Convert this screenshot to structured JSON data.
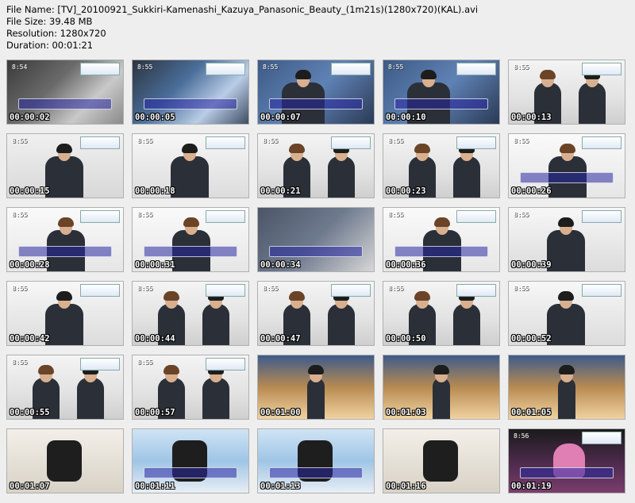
{
  "info": {
    "file_name": "File Name: [TV]_20100921_Sukkiri-Kamenashi_Kazuya_Panasonic_Beauty_(1m21s)(1280x720)(KAL).avi",
    "file_size": "File Size: 39.48 MB",
    "resolution": "Resolution: 1280x720",
    "duration": "Duration: 00:01:21"
  },
  "thumbnails": [
    {
      "ts": "00:00:02",
      "scene": "stage-dark",
      "clock": "8:54"
    },
    {
      "ts": "00:00:05",
      "scene": "stage-blue",
      "clock": "8:55"
    },
    {
      "ts": "00:00:07",
      "scene": "closeup-blue",
      "clock": "8:55"
    },
    {
      "ts": "00:00:10",
      "scene": "closeup-blue",
      "clock": "8:55"
    },
    {
      "ts": "00:00:13",
      "scene": "two-men",
      "clock": "8:55"
    },
    {
      "ts": "00:00:15",
      "scene": "side-man",
      "clock": "8:55"
    },
    {
      "ts": "00:00:18",
      "scene": "man-mic",
      "clock": "8:55"
    },
    {
      "ts": "00:00:21",
      "scene": "two-men",
      "clock": "8:55"
    },
    {
      "ts": "00:00:23",
      "scene": "two-men",
      "clock": "8:55"
    },
    {
      "ts": "00:00:26",
      "scene": "young-man",
      "clock": "8:55"
    },
    {
      "ts": "00:00:28",
      "scene": "young-man",
      "clock": "8:55"
    },
    {
      "ts": "00:00:31",
      "scene": "young-man",
      "clock": "8:55"
    },
    {
      "ts": "00:00:34",
      "scene": "pants",
      "clock": ""
    },
    {
      "ts": "00:00:36",
      "scene": "young-man",
      "clock": "8:55"
    },
    {
      "ts": "00:00:39",
      "scene": "man-mic",
      "clock": "8:55"
    },
    {
      "ts": "00:00:42",
      "scene": "man-mic",
      "clock": "8:55"
    },
    {
      "ts": "00:00:44",
      "scene": "two-men",
      "clock": "8:55"
    },
    {
      "ts": "00:00:47",
      "scene": "two-men",
      "clock": "8:55"
    },
    {
      "ts": "00:00:50",
      "scene": "two-men",
      "clock": "8:55"
    },
    {
      "ts": "00:00:52",
      "scene": "man-mic",
      "clock": "8:55"
    },
    {
      "ts": "00:00:55",
      "scene": "two-men",
      "clock": "8:55"
    },
    {
      "ts": "00:00:57",
      "scene": "two-men",
      "clock": "8:55"
    },
    {
      "ts": "00:01:00",
      "scene": "studio",
      "clock": ""
    },
    {
      "ts": "00:01:03",
      "scene": "studio",
      "clock": ""
    },
    {
      "ts": "00:01:05",
      "scene": "studio",
      "clock": ""
    },
    {
      "ts": "00:01:07",
      "scene": "product-dark",
      "clock": ""
    },
    {
      "ts": "00:01:11",
      "scene": "product-light",
      "clock": ""
    },
    {
      "ts": "00:01:13",
      "scene": "product-light",
      "clock": ""
    },
    {
      "ts": "00:01:16",
      "scene": "product-dark",
      "clock": ""
    },
    {
      "ts": "00:01:19",
      "scene": "steamer",
      "clock": "8:56"
    }
  ]
}
